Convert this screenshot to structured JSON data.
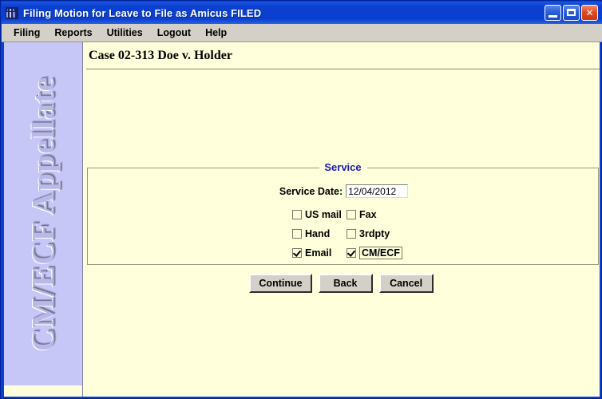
{
  "window": {
    "title": "Filing Motion for Leave to File as Amicus FILED",
    "icon": "cmecf-app-icon",
    "controls": {
      "minimize": "minimize-icon",
      "maximize": "maximize-icon",
      "close": "close-icon",
      "close_glyph": "✕"
    },
    "colors": {
      "titlebar": "#0a3fd0",
      "close_button": "#e34b22",
      "client_background": "#ffffdc",
      "sidebar": "#c6c6f7",
      "legend_text": "#1a1ab4",
      "menubar": "#d4d0c8"
    }
  },
  "menubar": {
    "items": [
      {
        "label": "Filing"
      },
      {
        "label": "Reports"
      },
      {
        "label": "Utilities"
      },
      {
        "label": "Logout"
      },
      {
        "label": "Help"
      }
    ]
  },
  "sidebar": {
    "brand": "CM/ECF Appellate"
  },
  "content": {
    "case_title": "Case 02-313 Doe v. Holder"
  },
  "service": {
    "legend": "Service",
    "date_label": "Service Date:",
    "date_value": "12/04/2012",
    "date_placeholder": "",
    "checkboxes": [
      {
        "label": "US mail",
        "checked": false,
        "focused": false,
        "column": "left",
        "row": 1
      },
      {
        "label": "Fax",
        "checked": false,
        "focused": false,
        "column": "right",
        "row": 1
      },
      {
        "label": "Hand",
        "checked": false,
        "focused": false,
        "column": "left",
        "row": 2
      },
      {
        "label": "3rdpty",
        "checked": false,
        "focused": false,
        "column": "right",
        "row": 2
      },
      {
        "label": "Email",
        "checked": true,
        "focused": false,
        "column": "left",
        "row": 3
      },
      {
        "label": "CM/ECF",
        "checked": true,
        "focused": true,
        "column": "right",
        "row": 3
      }
    ]
  },
  "buttons": {
    "continue": "Continue",
    "back": "Back",
    "cancel": "Cancel"
  }
}
